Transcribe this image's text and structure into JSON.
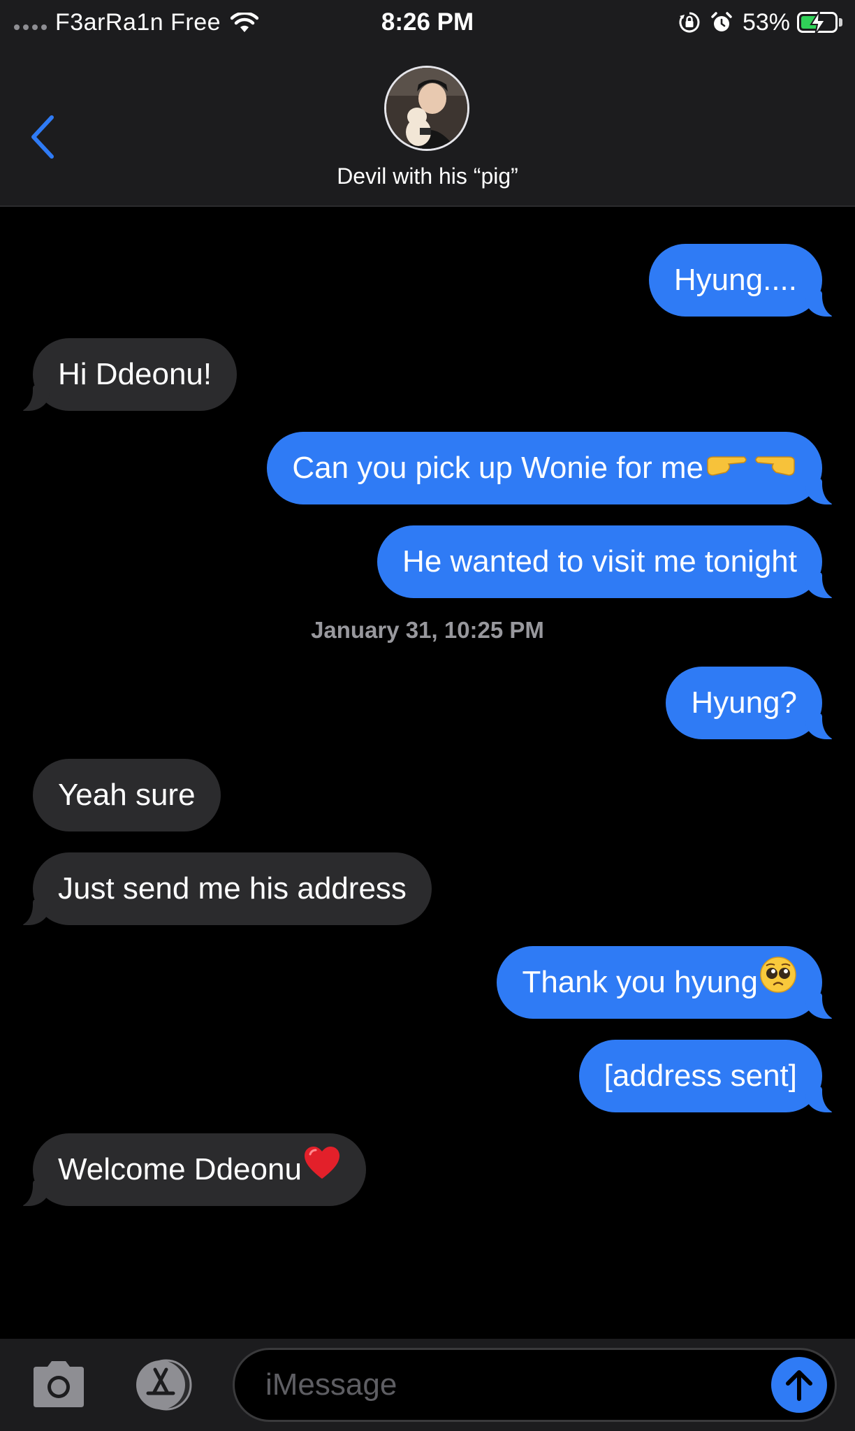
{
  "status_bar": {
    "carrier": "F3arRa1n Free",
    "time": "8:26 PM",
    "battery_percent": "53%",
    "battery_level": 0.53,
    "icons": [
      "signal-dots-icon",
      "wifi-icon",
      "orientation-lock-icon",
      "alarm-icon",
      "battery-charging-icon"
    ]
  },
  "header": {
    "back_icon": "chevron-left-icon",
    "contact_name": "Devil with his “pig”"
  },
  "colors": {
    "sent_bubble": "#2f7bf5",
    "received_bubble": "#2b2b2d",
    "background": "#000000",
    "accent": "#2f7bf5",
    "battery_fill": "#30d158"
  },
  "messages": [
    {
      "direction": "sent",
      "text": "Hyung...."
    },
    {
      "direction": "received",
      "text": "Hi Ddeonu!"
    },
    {
      "direction": "sent",
      "text": "Can you pick up Wonie for me",
      "emoji": [
        "pointing-right-emoji",
        "pointing-left-emoji"
      ]
    },
    {
      "direction": "sent",
      "text": "He wanted to visit me tonight"
    },
    {
      "direction": "sent",
      "text": "Hyung?"
    },
    {
      "direction": "received",
      "text": "Yeah sure"
    },
    {
      "direction": "received",
      "text": "Just send me his address"
    },
    {
      "direction": "sent",
      "text": "Thank you hyung",
      "emoji": [
        "pleading-face-emoji"
      ]
    },
    {
      "direction": "sent",
      "text": "[address sent]"
    },
    {
      "direction": "received",
      "text": "Welcome Ddeonu",
      "emoji": [
        "red-heart-emoji"
      ]
    }
  ],
  "timestamp": "January 31, 10:25 PM",
  "input_bar": {
    "placeholder": "iMessage",
    "icons": [
      "camera-icon",
      "app-store-icon",
      "send-arrow-icon"
    ]
  }
}
